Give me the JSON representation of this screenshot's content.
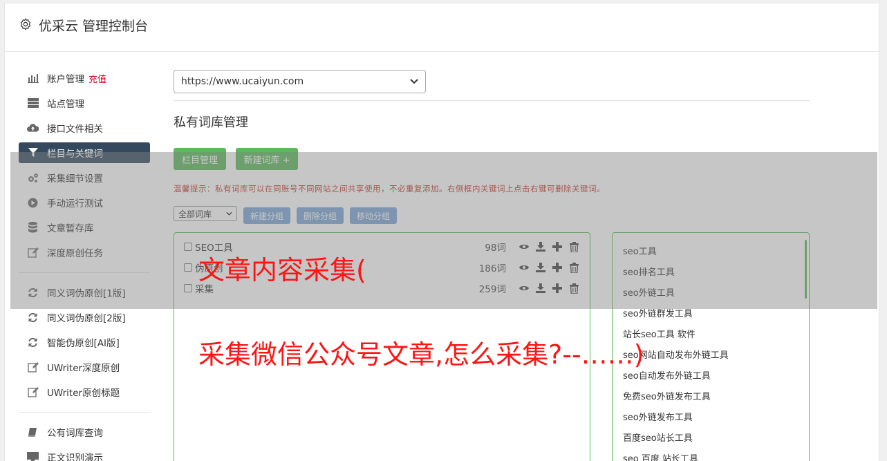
{
  "header": {
    "title": "优采云 管理控制台"
  },
  "sidebar": {
    "group1": [
      {
        "label": "账户管理",
        "badge": "充值",
        "icon": "bar-chart-icon",
        "active": false
      },
      {
        "label": "站点管理",
        "icon": "server-icon",
        "active": false
      },
      {
        "label": "接口文件相关",
        "icon": "cloud-upload-icon",
        "active": false
      },
      {
        "label": "栏目与关键词",
        "icon": "filter-icon",
        "active": true
      },
      {
        "label": "采集细节设置",
        "icon": "gears-icon",
        "active": false
      },
      {
        "label": "手动运行测试",
        "icon": "play-icon",
        "active": false
      },
      {
        "label": "文章暂存库",
        "icon": "database-icon",
        "active": false
      },
      {
        "label": "深度原创任务",
        "icon": "edit-icon",
        "active": false
      }
    ],
    "group2": [
      {
        "label": "同义词伪原创[1版]",
        "icon": "refresh-icon"
      },
      {
        "label": "同义词伪原创[2版]",
        "icon": "refresh-icon"
      },
      {
        "label": "智能伪原创[AI版]",
        "icon": "refresh-icon"
      },
      {
        "label": "UWriter深度原创",
        "icon": "edit-icon"
      },
      {
        "label": "UWriter原创标题",
        "icon": "edit-icon"
      }
    ],
    "group3": [
      {
        "label": "公有词库查询",
        "icon": "book-icon"
      },
      {
        "label": "正文识别演示",
        "icon": "monitor-icon"
      }
    ]
  },
  "main": {
    "site_select": "https://www.ucaiyun.com",
    "section_title": "私有词库管理",
    "btn_column": "栏目管理",
    "btn_new_lib": "新建词库 +",
    "tip": "温馨提示：私有词库可以在同账号不同网站之间共享使用，不必重复添加。右侧框内关键词上点击右键可删除关键词。",
    "group_select": "全部词库",
    "btn_new_group": "新建分组",
    "btn_delete_group": "删除分组",
    "btn_move_group": "移动分组",
    "libraries": [
      {
        "name": "SEO工具",
        "count": "98词"
      },
      {
        "name": "伪原创",
        "count": "186词"
      },
      {
        "name": "采集",
        "count": "259词"
      }
    ],
    "keywords": [
      "seo工具",
      "seo排名工具",
      "seo外链工具",
      "seo外链群发工具",
      "站长seo工具 软件",
      "seo网站自动发布外链工具",
      "seo自动发布外链工具",
      "免费seo外链发布工具",
      "seo外链发布工具",
      "百度seo站长工具",
      "seo 百度 站长工具"
    ]
  },
  "overlay_text": {
    "line1": "文章内容采集(",
    "line2": "采集微信公众号文章,怎么采集?--……)"
  },
  "colors": {
    "accent_green": "#5cb85c",
    "sidebar_active": "#34495e",
    "tip_red": "#c0392b",
    "banner_red": "#ff1414",
    "group_btn_blue": "#7aa7d8"
  }
}
